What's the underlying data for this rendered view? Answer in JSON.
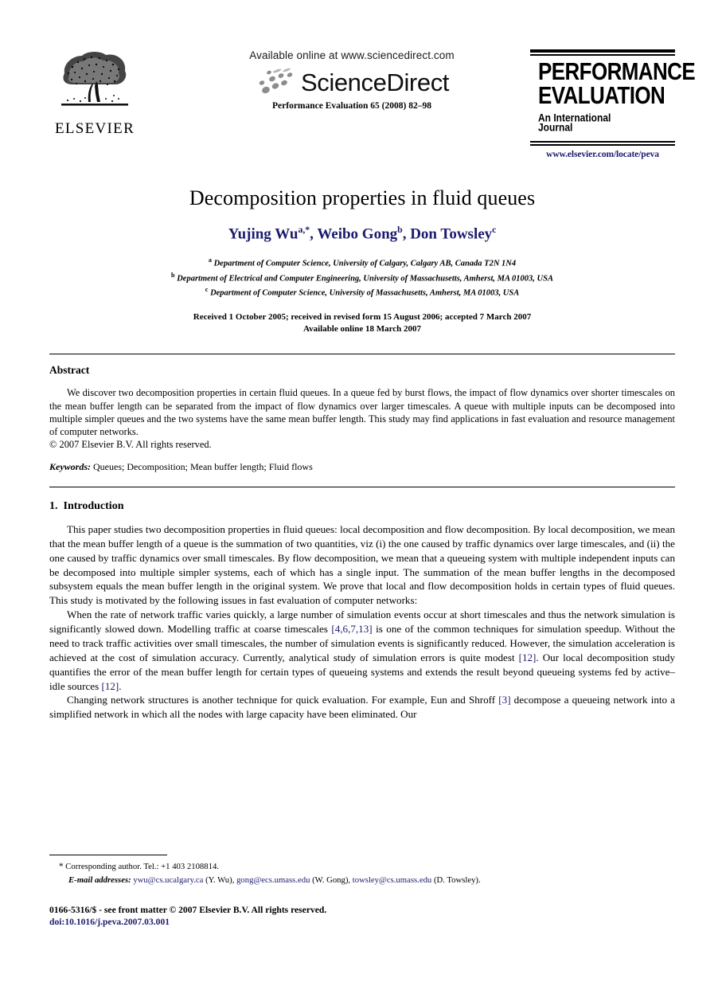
{
  "masthead": {
    "publisher_name": "ELSEVIER",
    "publisher_logo_icon": "elsevier-tree-logo",
    "available_online": "Available online at www.sciencedirect.com",
    "sciencedirect_wordmark": "ScienceDirect",
    "sciencedirect_icon": "sciencedirect-swoosh-icon",
    "journal_reference": "Performance Evaluation 65 (2008) 82–98",
    "journal_logo": {
      "title_line1": "PERFORMANCE",
      "title_line2": "EVALUATION",
      "subtitle_line1": "An International",
      "subtitle_line2": "Journal",
      "url": "www.elsevier.com/locate/peva"
    }
  },
  "article": {
    "title": "Decomposition properties in fluid queues",
    "authors_html": "Yujing Wu<sup>a,*</sup>, Weibo Gong<sup>b</sup>, Don Towsley<sup>c</sup>",
    "affiliations": [
      {
        "marker": "a",
        "text": "Department of Computer Science, University of Calgary, Calgary AB, Canada T2N 1N4"
      },
      {
        "marker": "b",
        "text": "Department of Electrical and Computer Engineering, University of Massachusetts, Amherst, MA 01003, USA"
      },
      {
        "marker": "c",
        "text": "Department of Computer Science, University of Massachusetts, Amherst, MA 01003, USA"
      }
    ],
    "history_line": "Received 1 October 2005; received in revised form 15 August 2006; accepted 7 March 2007",
    "available_line": "Available online 18 March 2007"
  },
  "abstract": {
    "heading": "Abstract",
    "text": "We discover two decomposition properties in certain fluid queues. In a queue fed by burst flows, the impact of flow dynamics over shorter timescales on the mean buffer length can be separated from the impact of flow dynamics over larger timescales. A queue with multiple inputs can be decomposed into multiple simpler queues and the two systems have the same mean buffer length. This study may find applications in fast evaluation and resource management of computer networks.",
    "copyright": "© 2007 Elsevier B.V. All rights reserved.",
    "keywords_label": "Keywords:",
    "keywords_value": "Queues; Decomposition; Mean buffer length; Fluid flows"
  },
  "introduction": {
    "number": "1.",
    "heading": "Introduction",
    "paragraph_1": "This paper studies two decomposition properties in fluid queues: local decomposition and flow decomposition. By local decomposition, we mean that the mean buffer length of a queue is the summation of two quantities, viz (i) the one caused by traffic dynamics over large timescales, and (ii) the one caused by traffic dynamics over small timescales. By flow decomposition, we mean that a queueing system with multiple independent inputs can be decomposed into multiple simpler systems, each of which has a single input. The summation of the mean buffer lengths in the decomposed subsystem equals the mean buffer length in the original system. We prove that local and flow decomposition holds in certain types of fluid queues. This study is motivated by the following issues in fast evaluation of computer networks:",
    "paragraph_2_part1": "When the rate of network traffic varies quickly, a large number of simulation events occur at short timescales and thus the network simulation is significantly slowed down. Modelling traffic at coarse timescales ",
    "paragraph_2_cite1": "[4,6,7,13]",
    "paragraph_2_part2": " is one of the common techniques for simulation speedup. Without the need to track traffic activities over small timescales, the number of simulation events is significantly reduced. However, the simulation acceleration is achieved at the cost of simulation accuracy. Currently, analytical study of simulation errors is quite modest ",
    "paragraph_2_cite2": "[12]",
    "paragraph_2_part3": ". Our local decomposition study quantifies the error of the mean buffer length for certain types of queueing systems and extends the result beyond queueing systems fed by active–idle sources ",
    "paragraph_2_cite3": "[12]",
    "paragraph_2_part4": ".",
    "paragraph_3_part1": "Changing network structures is another technique for quick evaluation. For example, Eun and Shroff ",
    "paragraph_3_cite1": "[3]",
    "paragraph_3_part2": " decompose a queueing network into a simplified network in which all the nodes with large capacity have been eliminated. Our"
  },
  "footnotes": {
    "corresponding_marker": "*",
    "corresponding_text": "Corresponding author. Tel.: +1 403 2108814.",
    "email_label": "E-mail addresses:",
    "emails": [
      {
        "address": "ywu@cs.ucalgary.ca",
        "name": "(Y. Wu),"
      },
      {
        "address": "gong@ecs.umass.edu",
        "name": "(W. Gong),"
      },
      {
        "address": "towsley@cs.umass.edu",
        "name": "(D. Towsley)."
      }
    ],
    "issn_line": "0166-5316/$ - see front matter © 2007 Elsevier B.V. All rights reserved.",
    "doi_line": "doi:10.1016/j.peva.2007.03.001"
  },
  "colors": {
    "link_navy": "#1b1b6e",
    "text_black": "#000000",
    "page_background": "#ffffff"
  }
}
